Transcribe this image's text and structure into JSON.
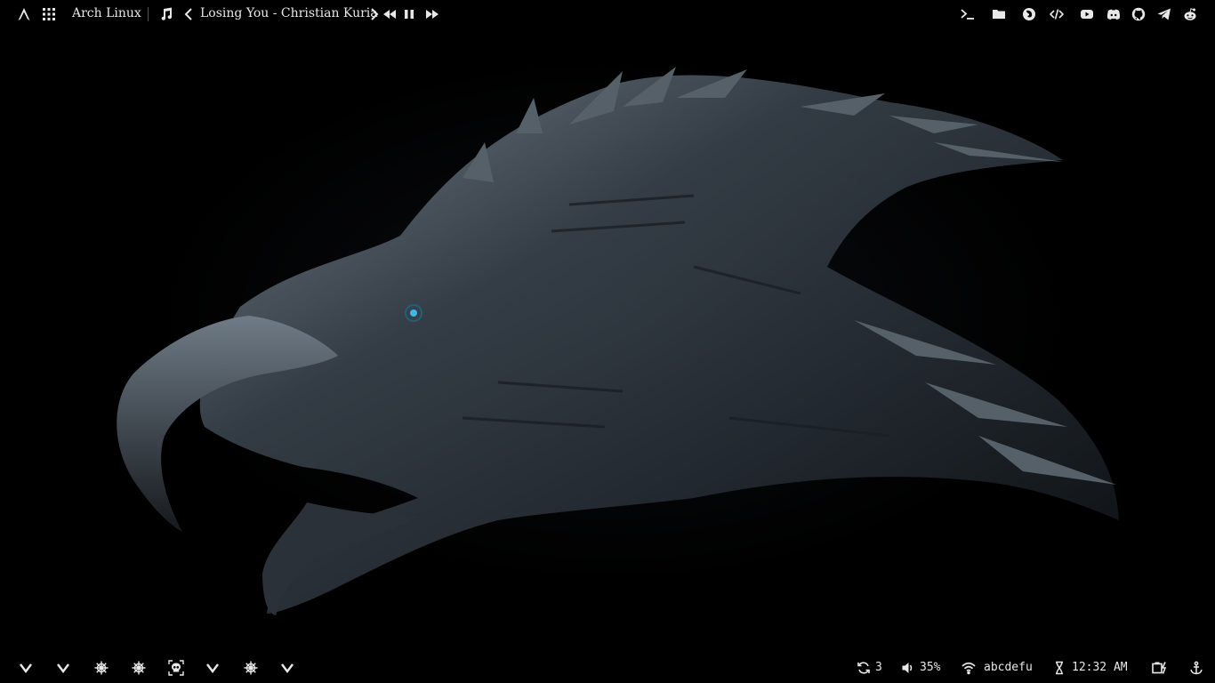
{
  "top_bar": {
    "distro_label": "Arch Linux",
    "now_playing": "Losing You - Christian Kuria",
    "left_icons": [
      "arch-logo-icon",
      "app-grid-icon"
    ],
    "media_icons": [
      "music-note-icon",
      "previous-chevron-icon",
      "next-chevron-icon",
      "rewind-icon",
      "pause-icon",
      "fast-forward-icon"
    ],
    "launchers": [
      "terminal-icon",
      "folder-icon",
      "firefox-icon",
      "code-icon",
      "youtube-icon",
      "discord-icon",
      "github-icon",
      "telegram-icon",
      "reddit-icon"
    ]
  },
  "bottom_bar": {
    "workspaces": [
      "chevron-down-icon",
      "chevron-down-icon",
      "ship-wheel-icon",
      "ship-wheel-icon",
      "skull-icon",
      "chevron-down-icon",
      "ship-wheel-icon",
      "chevron-down-icon"
    ],
    "updates_count": "3",
    "volume": "35%",
    "wifi_name": "abcdefu",
    "clock": "12:32 AM"
  },
  "colors": {
    "bar_text": "#e8e8e8",
    "background": "#000000"
  }
}
